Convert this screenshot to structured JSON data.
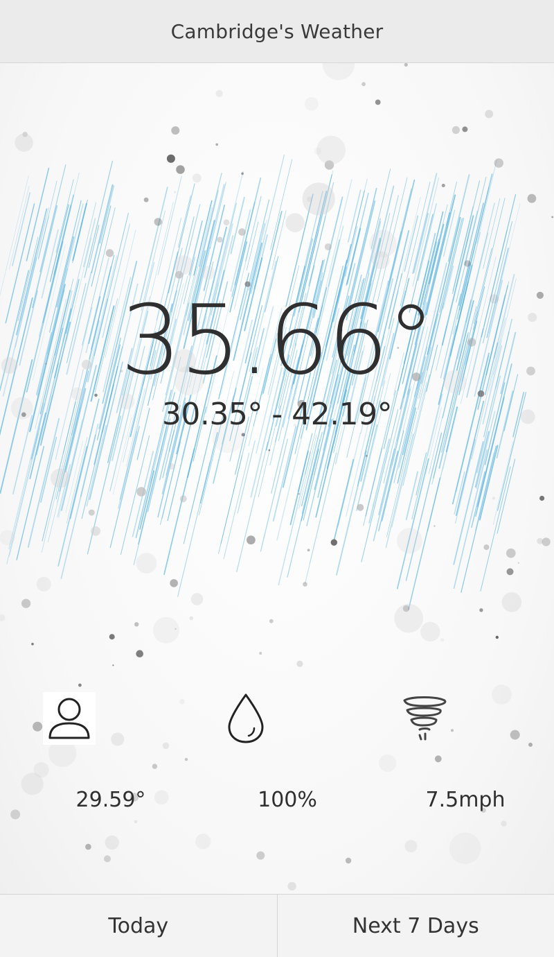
{
  "header": {
    "title": "Cambridge's Weather"
  },
  "current": {
    "temperature": "35.66°",
    "range": "30.35° - 42.19°",
    "condition": "rain"
  },
  "stats": [
    {
      "icon": "person-icon",
      "value": "29.59°"
    },
    {
      "icon": "droplet-icon",
      "value": "100%"
    },
    {
      "icon": "tornado-icon",
      "value": "7.5mph"
    }
  ],
  "footer": {
    "tabs": [
      {
        "label": "Today"
      },
      {
        "label": "Next 7 Days"
      }
    ]
  },
  "colors": {
    "rain": "#5bb4de",
    "text": "#2f2f2f",
    "header_bg": "#ebebeb"
  }
}
